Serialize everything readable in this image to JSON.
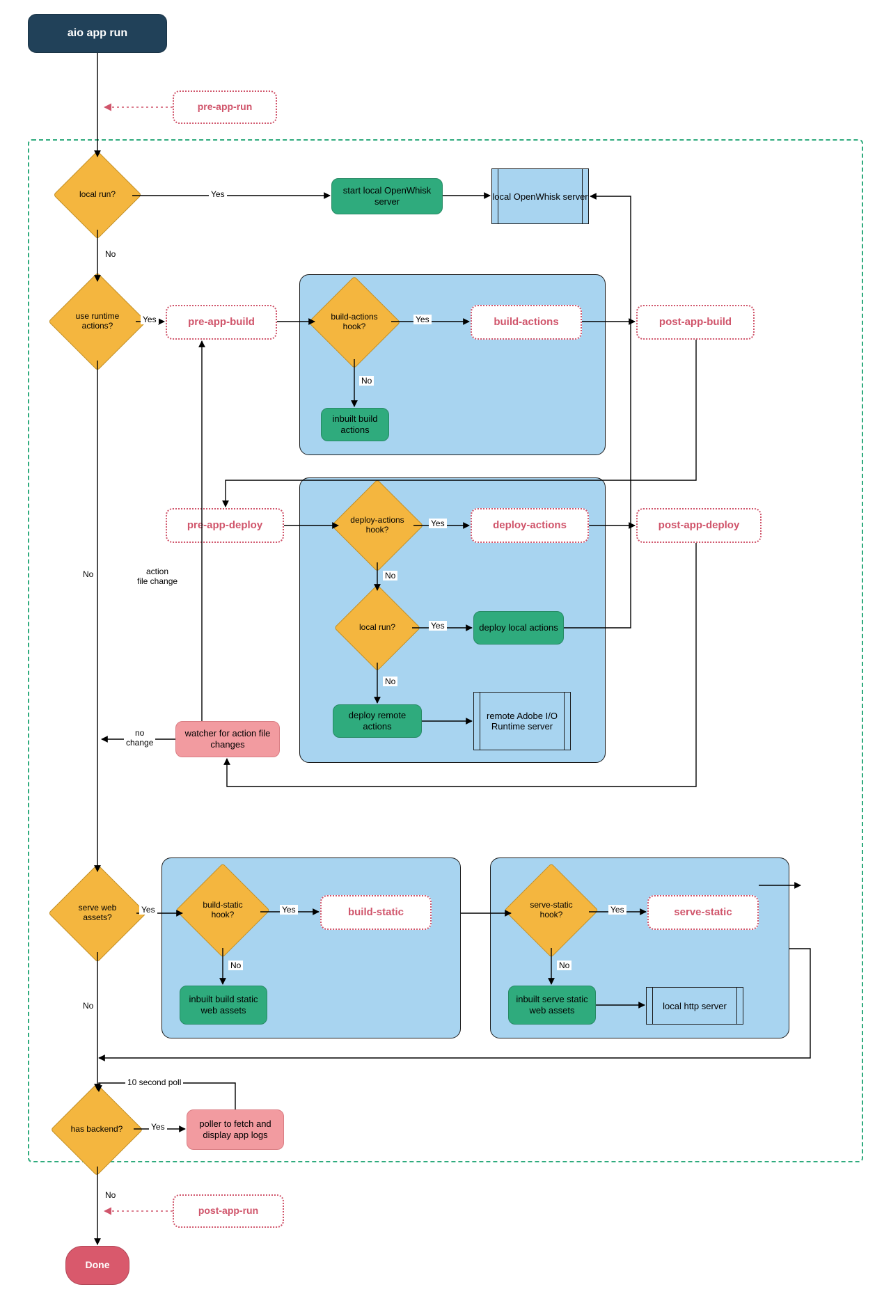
{
  "start": "aio app run",
  "done": "Done",
  "hooks": {
    "pre_app_run": "pre-app-run",
    "pre_app_build": "pre-app-build",
    "build_actions": "build-actions",
    "post_app_build": "post-app-build",
    "pre_app_deploy": "pre-app-deploy",
    "deploy_actions": "deploy-actions",
    "post_app_deploy": "post-app-deploy",
    "build_static": "build-static",
    "serve_static": "serve-static",
    "post_app_run": "post-app-run"
  },
  "decisions": {
    "local_run": "local run?",
    "use_runtime_actions": "use runtime\nactions?",
    "build_actions_hook": "build-actions\nhook?",
    "deploy_actions_hook": "deploy-actions\nhook?",
    "local_run2": "local run?",
    "serve_web_assets": "serve web\nassets?",
    "build_static_hook": "build-static\nhook?",
    "serve_static_hook": "serve-static\nhook?",
    "has_backend": "has backend?"
  },
  "actions": {
    "start_local_openwhisk": "start local\nOpenWhisk server",
    "local_openwhisk_server": "local\nOpenWhisk\nserver",
    "inbuilt_build_actions": "inbuilt\nbuild actions",
    "deploy_local_actions": "deploy local\nactions",
    "deploy_remote_actions": "deploy remote\nactions",
    "remote_adobe_runtime": "remote\nAdobe I/O\nRuntime\nserver",
    "watcher": "watcher for action\nfile changes",
    "inbuilt_build_static": "inbuilt\nbuild static web\nassets",
    "inbuilt_serve_static": "inbuilt\nserve static web\nassets",
    "local_http_server": "local http\nserver",
    "poller": "poller to\nfetch and display\napp logs"
  },
  "edge_labels": {
    "yes": "Yes",
    "no": "No",
    "action_file_change": "action\nfile change",
    "no_change": "no\nchange",
    "ten_second_poll": "10 second poll"
  }
}
